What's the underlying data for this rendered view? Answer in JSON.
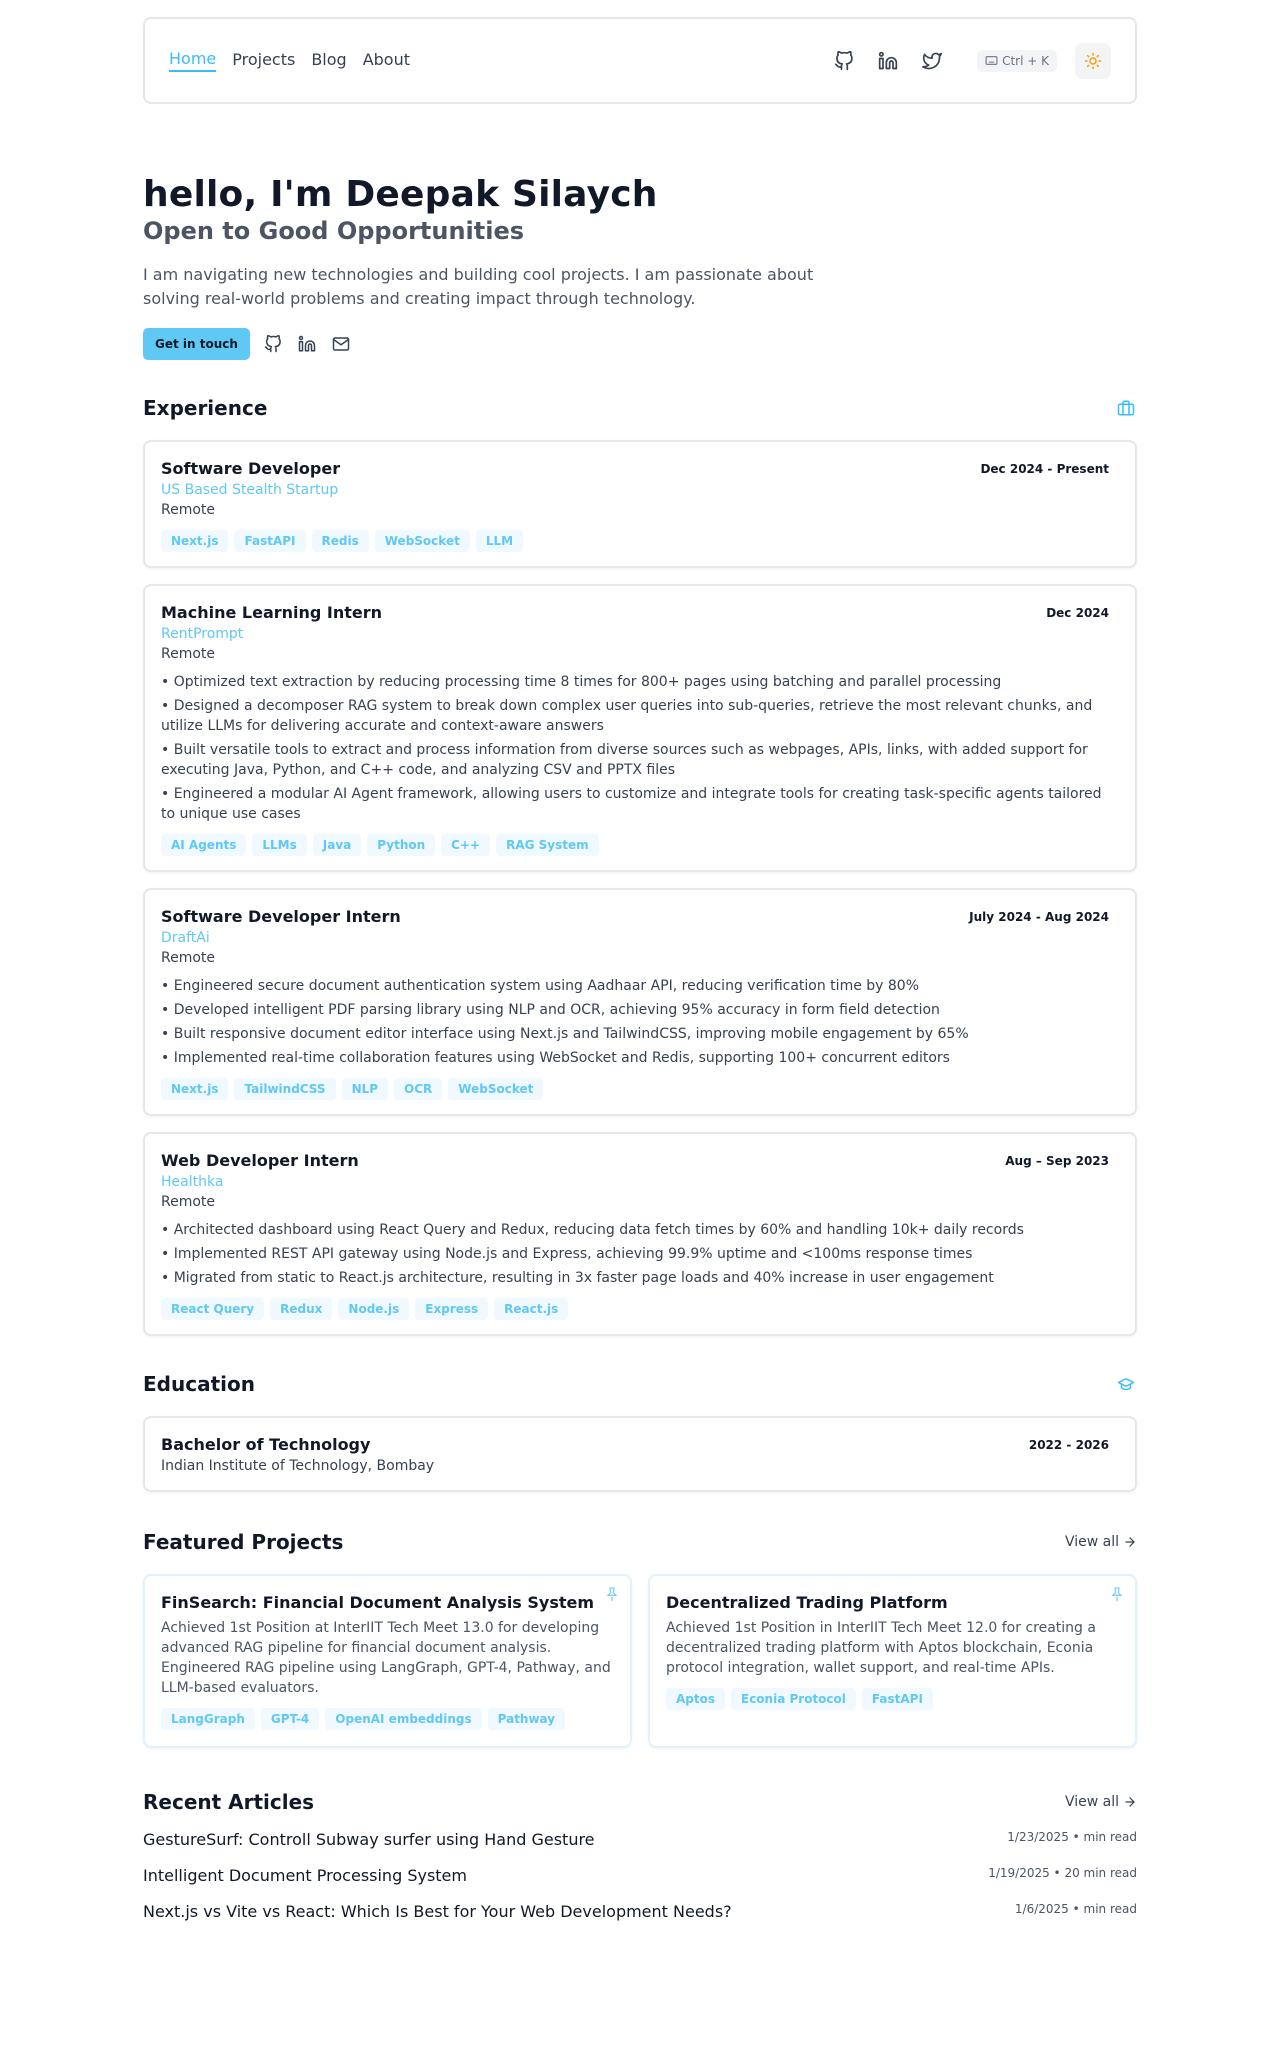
{
  "nav": {
    "links": [
      "Home",
      "Projects",
      "Blog",
      "About"
    ],
    "shortcut": "Ctrl + K",
    "icons": [
      "github-icon",
      "linkedin-icon",
      "twitter-icon",
      "keyboard-icon",
      "sun-icon"
    ]
  },
  "hero": {
    "title": "hello, I'm Deepak Silaych",
    "subtitle": "Open to Good Opportunities",
    "description": "I am navigating new technologies and building cool projects. I am passionate about solving real-world problems and creating impact through technology.",
    "cta": "Get in touch"
  },
  "experience": {
    "title": "Experience",
    "items": [
      {
        "role": "Software Developer",
        "company": "US Based Stealth Startup",
        "location": "Remote",
        "date": "Dec 2024 - Present",
        "bullets": [],
        "tags": [
          "Next.js",
          "FastAPI",
          "Redis",
          "WebSocket",
          "LLM"
        ]
      },
      {
        "role": "Machine Learning Intern",
        "company": "RentPrompt",
        "location": "Remote",
        "date": "Dec 2024",
        "bullets": [
          "• Optimized text extraction by reducing processing time 8 times for 800+ pages using batching and parallel processing",
          "• Designed a decomposer RAG system to break down complex user queries into sub-queries, retrieve the most relevant chunks, and utilize LLMs for delivering accurate and context-aware answers",
          "• Built versatile tools to extract and process information from diverse sources such as webpages, APIs, links, with added support for executing Java, Python, and C++ code, and analyzing CSV and PPTX files",
          "• Engineered a modular AI Agent framework, allowing users to customize and integrate tools for creating task-specific agents tailored to unique use cases"
        ],
        "tags": [
          "AI Agents",
          "LLMs",
          "Java",
          "Python",
          "C++",
          "RAG System"
        ]
      },
      {
        "role": "Software Developer Intern",
        "company": "DraftAi",
        "location": "Remote",
        "date": "July 2024 - Aug 2024",
        "bullets": [
          "• Engineered secure document authentication system using Aadhaar API, reducing verification time by 80%",
          "• Developed intelligent PDF parsing library using NLP and OCR, achieving 95% accuracy in form field detection",
          "• Built responsive document editor interface using Next.js and TailwindCSS, improving mobile engagement by 65%",
          "• Implemented real-time collaboration features using WebSocket and Redis, supporting 100+ concurrent editors"
        ],
        "tags": [
          "Next.js",
          "TailwindCSS",
          "NLP",
          "OCR",
          "WebSocket"
        ]
      },
      {
        "role": "Web Developer Intern",
        "company": "Healthka",
        "location": "Remote",
        "date": "Aug – Sep 2023",
        "bullets": [
          "• Architected dashboard using React Query and Redux, reducing data fetch times by 60% and handling 10k+ daily records",
          "• Implemented REST API gateway using Node.js and Express, achieving 99.9% uptime and <100ms response times",
          "• Migrated from static to React.js architecture, resulting in 3x faster page loads and 40% increase in user engagement"
        ],
        "tags": [
          "React Query",
          "Redux",
          "Node.js",
          "Express",
          "React.js"
        ]
      }
    ]
  },
  "education": {
    "title": "Education",
    "degree": "Bachelor of Technology",
    "school": "Indian Institute of Technology, Bombay",
    "date": "2022 - 2026"
  },
  "projects": {
    "title": "Featured Projects",
    "view_all": "View all",
    "items": [
      {
        "title": "FinSearch: Financial Document Analysis System",
        "description": "Achieved 1st Position at InterIIT Tech Meet 13.0 for developing advanced RAG pipeline for financial document analysis. Engineered RAG pipeline using LangGraph, GPT-4, Pathway, and LLM-based evaluators.",
        "tags": [
          "LangGraph",
          "GPT-4",
          "OpenAI embeddings",
          "Pathway"
        ]
      },
      {
        "title": "Decentralized Trading Platform",
        "description": "Achieved 1st Position in InterIIT Tech Meet 12.0 for creating a decentralized trading platform with Aptos blockchain, Econia protocol integration, wallet support, and real-time APIs.",
        "tags": [
          "Aptos",
          "Econia Protocol",
          "FastAPI"
        ]
      }
    ]
  },
  "articles": {
    "title": "Recent Articles",
    "view_all": "View all",
    "items": [
      {
        "title": "GestureSurf: Controll Subway surfer using Hand Gesture",
        "meta": "1/23/2025 • min read"
      },
      {
        "title": "Intelligent Document Processing System",
        "meta": "1/19/2025 • 20 min read"
      },
      {
        "title": "Next.js vs Vite vs React: Which Is Best for Your Web Development Needs?",
        "meta": "1/6/2025 • min read"
      }
    ]
  },
  "colors": {
    "accent": "#38bdf8",
    "accent_button": "#5fc8f3",
    "tag_bg": "#f0f9ff"
  }
}
